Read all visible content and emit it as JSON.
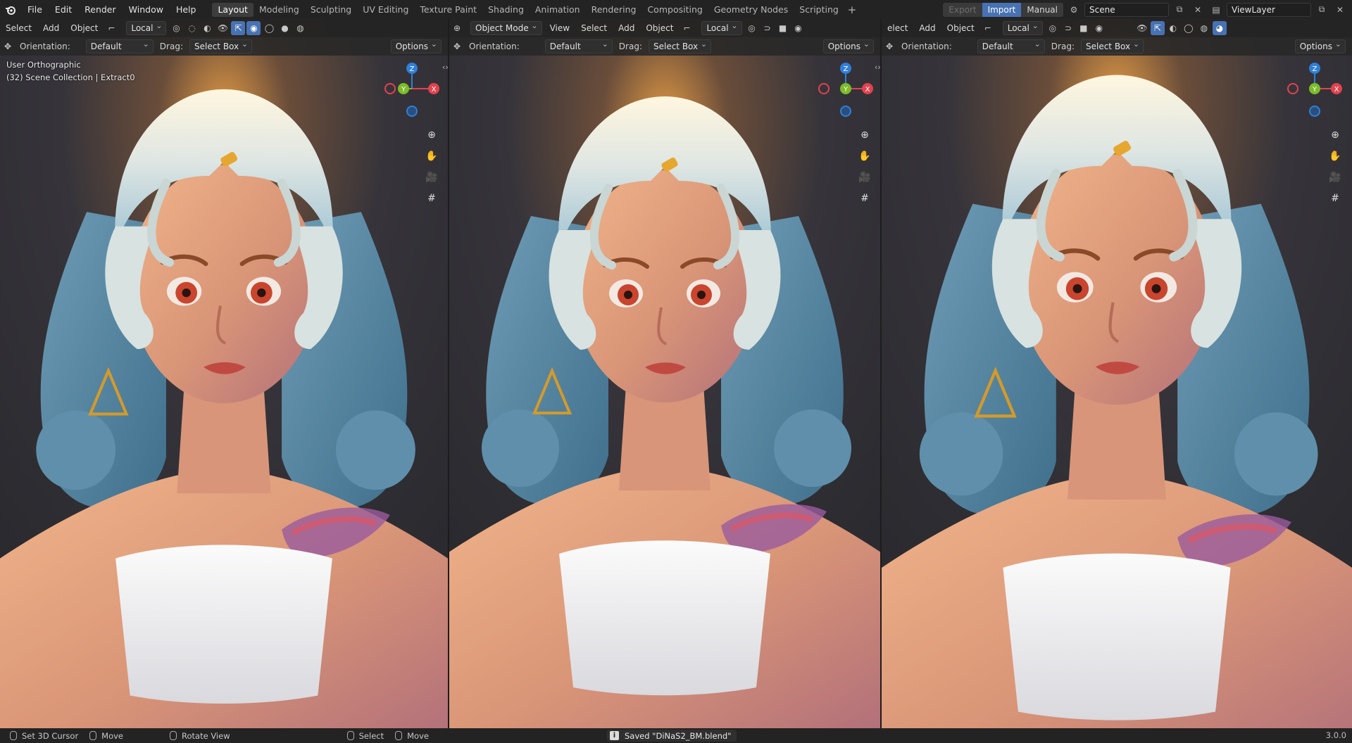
{
  "topbar": {
    "menus": [
      "File",
      "Edit",
      "Render",
      "Window",
      "Help"
    ],
    "workspaces": [
      "Layout",
      "Modeling",
      "Sculpting",
      "UV Editing",
      "Texture Paint",
      "Shading",
      "Animation",
      "Rendering",
      "Compositing",
      "Geometry Nodes",
      "Scripting"
    ],
    "active_workspace": "Layout",
    "add_tab": "+",
    "export_label": "Export",
    "import_label": "Import",
    "manual_label": "Manual",
    "scene_name": "Scene",
    "view_layer": "ViewLayer"
  },
  "viewport1": {
    "menus": [
      "Select",
      "Add",
      "Object"
    ],
    "transform": "Local",
    "orientation_label": "Orientation:",
    "orientation_value": "Default",
    "drag_label": "Drag:",
    "drag_value": "Select Box",
    "options": "Options",
    "view_name": "User Orthographic",
    "collection": "(32) Scene Collection | Extract0"
  },
  "viewport2": {
    "mode": "Object Mode",
    "menus": [
      "View",
      "Select",
      "Add",
      "Object"
    ],
    "transform": "Local",
    "orientation_label": "Orientation:",
    "orientation_value": "Default",
    "drag_label": "Drag:",
    "drag_value": "Select Box",
    "options": "Options"
  },
  "viewport3": {
    "menus": [
      "elect",
      "Add",
      "Object"
    ],
    "transform": "Local",
    "orientation_label": "Orientation:",
    "orientation_value": "Default",
    "drag_label": "Drag:",
    "drag_value": "Select Box",
    "options": "Options"
  },
  "gizmo": {
    "z": "Z",
    "y": "Y",
    "x": "X"
  },
  "status": {
    "set_cursor": "Set 3D Cursor",
    "move": "Move",
    "rotate_view": "Rotate View",
    "select": "Select",
    "move2": "Move",
    "saved_message": "Saved \"DiNaS2_BM.blend\"",
    "version": "3.0.0"
  },
  "colors": {
    "accent_blue": "#4772b3",
    "axis_x": "#e0434f",
    "axis_y": "#7dbb2a",
    "axis_z": "#2f7fd8",
    "background": "#2b2b2b"
  }
}
